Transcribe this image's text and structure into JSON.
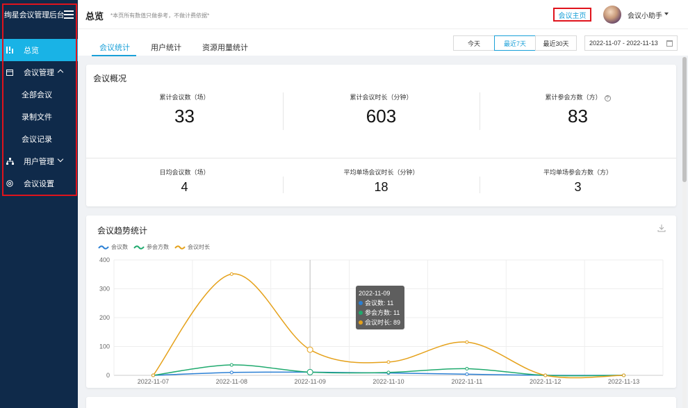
{
  "sidebar": {
    "brand": "绚星会议管理后台",
    "items": [
      {
        "label": "总览"
      },
      {
        "label": "会议管理"
      },
      {
        "label": "全部会议"
      },
      {
        "label": "录制文件"
      },
      {
        "label": "会议记录"
      },
      {
        "label": "用户管理"
      },
      {
        "label": "会议设置"
      }
    ]
  },
  "header": {
    "title": "总览",
    "note": "*本页所有数值只做参考，不做计费依据*",
    "home_link": "会议主页",
    "user_name": "会议小助手"
  },
  "tabs": [
    {
      "label": "会议统计"
    },
    {
      "label": "用户统计"
    },
    {
      "label": "资源用量统计"
    }
  ],
  "range": {
    "buttons": [
      {
        "label": "今天"
      },
      {
        "label": "最近7天"
      },
      {
        "label": "最近30天"
      }
    ],
    "selected": "最近7天",
    "date_range": "2022-11-07 - 2022-11-13"
  },
  "overview": {
    "title": "会议概况",
    "top": [
      {
        "label": "累计会议数（场）",
        "value": "33"
      },
      {
        "label": "累计会议时长（分钟）",
        "value": "603"
      },
      {
        "label": "累计参会方数（方）",
        "value": "83"
      }
    ],
    "bottom": [
      {
        "label": "日均会议数（场）",
        "value": "4"
      },
      {
        "label": "平均单场会议时长（分钟）",
        "value": "18"
      },
      {
        "label": "平均单场参会方数（方）",
        "value": "3"
      }
    ],
    "help_glyph": "?"
  },
  "trend": {
    "title": "会议趋势统计",
    "tooltip": {
      "date": "2022-11-09",
      "rows": [
        {
          "label": "会议数: 11"
        },
        {
          "label": "参会方数: 11"
        },
        {
          "label": "会议时长: 89"
        }
      ]
    }
  },
  "colors": {
    "sidebar_bg": "#0f2a4a",
    "accent": "#19b3e6",
    "series_meetings": "#2a7fd4",
    "series_participants": "#1faa6e",
    "series_duration": "#e5a11a"
  },
  "chart_data": {
    "type": "line",
    "title": "",
    "x": [
      "2022-11-07",
      "2022-11-08",
      "2022-11-09",
      "2022-11-10",
      "2022-11-11",
      "2022-11-12",
      "2022-11-13"
    ],
    "ylim": [
      0,
      400
    ],
    "yticks": [
      0,
      100,
      200,
      300,
      400
    ],
    "grid": true,
    "legend": "top-left",
    "series": [
      {
        "name": "会议数",
        "values": [
          0,
          10,
          11,
          8,
          4,
          0,
          0
        ],
        "color": "#2a7fd4"
      },
      {
        "name": "参会方数",
        "values": [
          0,
          36,
          11,
          10,
          23,
          0,
          0
        ],
        "color": "#1faa6e"
      },
      {
        "name": "会议时长",
        "values": [
          0,
          351,
          89,
          46,
          115,
          0,
          0
        ],
        "color": "#e5a11a"
      }
    ]
  }
}
